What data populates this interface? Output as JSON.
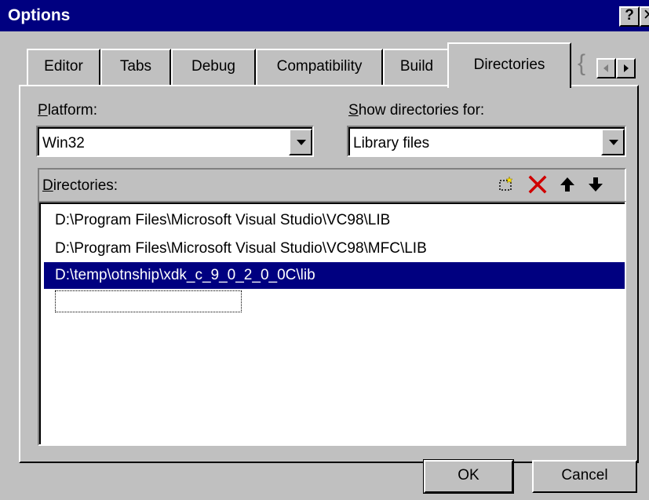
{
  "window": {
    "title": "Options",
    "help_label": "?",
    "close_label": "✕"
  },
  "tabs": [
    {
      "label": "Editor",
      "active": false
    },
    {
      "label": "Tabs",
      "active": false
    },
    {
      "label": "Debug",
      "active": false
    },
    {
      "label": "Compatibility",
      "active": false
    },
    {
      "label": "Build",
      "active": false
    },
    {
      "label": "Directories",
      "active": true
    }
  ],
  "platform": {
    "label_prefix": "P",
    "label_rest": "latform:",
    "value": "Win32"
  },
  "show_for": {
    "label_prefix": "S",
    "label_rest": "how directories for:",
    "value": "Library files"
  },
  "directories": {
    "label_prefix": "D",
    "label_rest": "irectories:",
    "items": [
      {
        "path": "D:\\Program Files\\Microsoft Visual Studio\\VC98\\LIB",
        "selected": false
      },
      {
        "path": "D:\\Program Files\\Microsoft Visual Studio\\VC98\\MFC\\LIB",
        "selected": false
      },
      {
        "path": "D:\\temp\\otnship\\xdk_c_9_0_2_0_0C\\lib",
        "selected": true
      }
    ]
  },
  "toolbar": {
    "new_icon": "new-folder-icon",
    "delete_icon": "delete-x-icon",
    "up_icon": "move-up-arrow-icon",
    "down_icon": "move-down-arrow-icon",
    "delete_color": "#d00000"
  },
  "buttons": {
    "ok": "OK",
    "cancel": "Cancel"
  },
  "colors": {
    "title_bar": "#000080",
    "face": "#c0c0c0",
    "selection": "#000080"
  }
}
